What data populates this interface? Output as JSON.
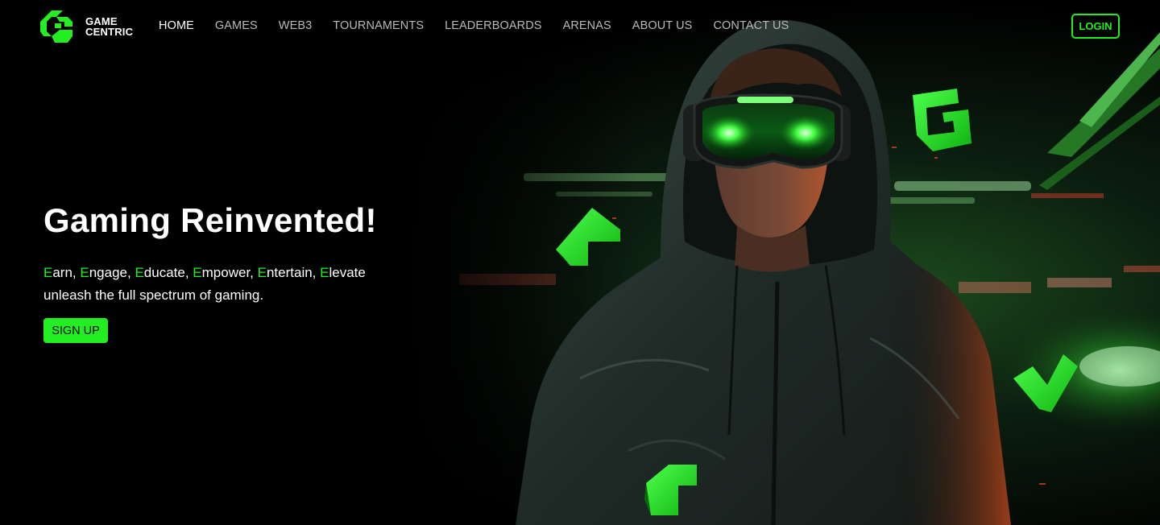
{
  "brand": {
    "logo_line1": "GAME",
    "logo_line2": "CENTRIC",
    "logo_icon": "game-centric-logo-icon",
    "accent_color": "#22ee22"
  },
  "nav": {
    "items": [
      {
        "label": "HOME",
        "active": true
      },
      {
        "label": "GAMES",
        "active": false
      },
      {
        "label": "WEB3",
        "active": false
      },
      {
        "label": "TOURNAMENTS",
        "active": false
      },
      {
        "label": "LEADERBOARDS",
        "active": false
      },
      {
        "label": "ARENAS",
        "active": false
      },
      {
        "label": "ABOUT US",
        "active": false
      },
      {
        "label": "CONTACT US",
        "active": false
      }
    ],
    "login_label": "LOGIN"
  },
  "hero": {
    "title": "Gaming Reinvented!",
    "tagline_words": [
      {
        "first": "E",
        "rest": "arn"
      },
      {
        "first": "E",
        "rest": "ngage"
      },
      {
        "first": "E",
        "rest": "ducate"
      },
      {
        "first": "E",
        "rest": "mpower"
      },
      {
        "first": "E",
        "rest": "ntertain"
      },
      {
        "first": "E",
        "rest": "levate"
      }
    ],
    "separator": ", ",
    "tagline_line2": "unleash the full spectrum of gaming.",
    "signup_label": "SIGN UP",
    "image": "gamer-in-hoodie-with-vr-goggles-in-stadium"
  }
}
